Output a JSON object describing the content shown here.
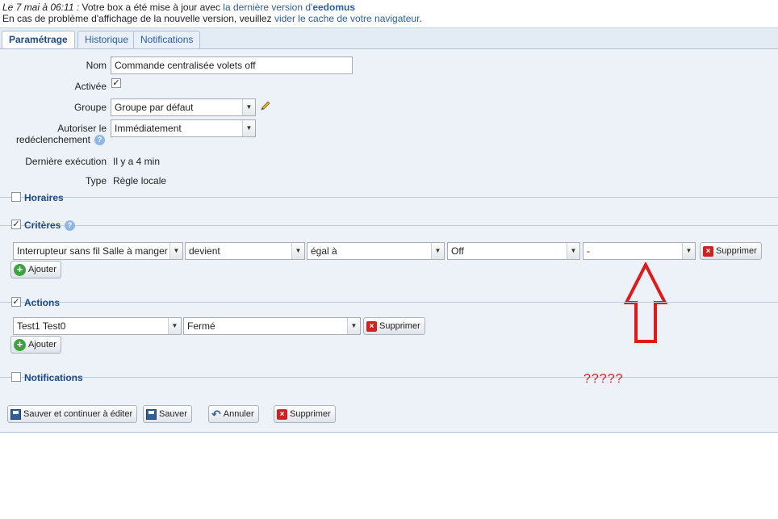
{
  "notice": {
    "date": "Le 7 mai à 06:11 :",
    "line1_text": " Votre box a été mise à jour avec ",
    "line1_link": "la dernière version d'",
    "brand": "eedomus",
    "line2_text": "En cas de problème d'affichage de la nouvelle version, veuillez ",
    "line2_link": "vider le cache de votre navigateur",
    "line2_end": "."
  },
  "tabs": [
    "Paramétrage",
    "Historique",
    "Notifications"
  ],
  "form": {
    "nom_label": "Nom",
    "nom_value": "Commande centralisée volets off",
    "active_label": "Activée",
    "groupe_label": "Groupe",
    "groupe_value": "Groupe par défaut",
    "autoriser_label_1": "Autoriser le",
    "autoriser_label_2": "redéclenchement",
    "autoriser_value": "Immédiatement",
    "derniere_label": "Dernière exécution",
    "derniere_value": "Il y a 4 min",
    "type_label": "Type",
    "type_value": "Règle locale"
  },
  "sections": {
    "horaires": "Horaires",
    "criteres": "Critères",
    "actions": "Actions",
    "notifications": "Notifications"
  },
  "criteria": {
    "device": "Interrupteur sans fil Salle à manger",
    "condition": "devient",
    "operator": "égal à",
    "value": "Off",
    "extra": "-",
    "delete": "Supprimer",
    "add": "Ajouter"
  },
  "actions": {
    "device": "Test1 Test0",
    "value": "Fermé",
    "delete": "Supprimer",
    "add": "Ajouter"
  },
  "annotation": "?????",
  "buttons": {
    "save_continue": "Sauver et continuer à éditer",
    "save": "Sauver",
    "cancel": "Annuler",
    "delete": "Supprimer"
  },
  "colors": {
    "link": "#2b5ea8",
    "panel": "#edf2f9",
    "annotation": "#d42020"
  }
}
